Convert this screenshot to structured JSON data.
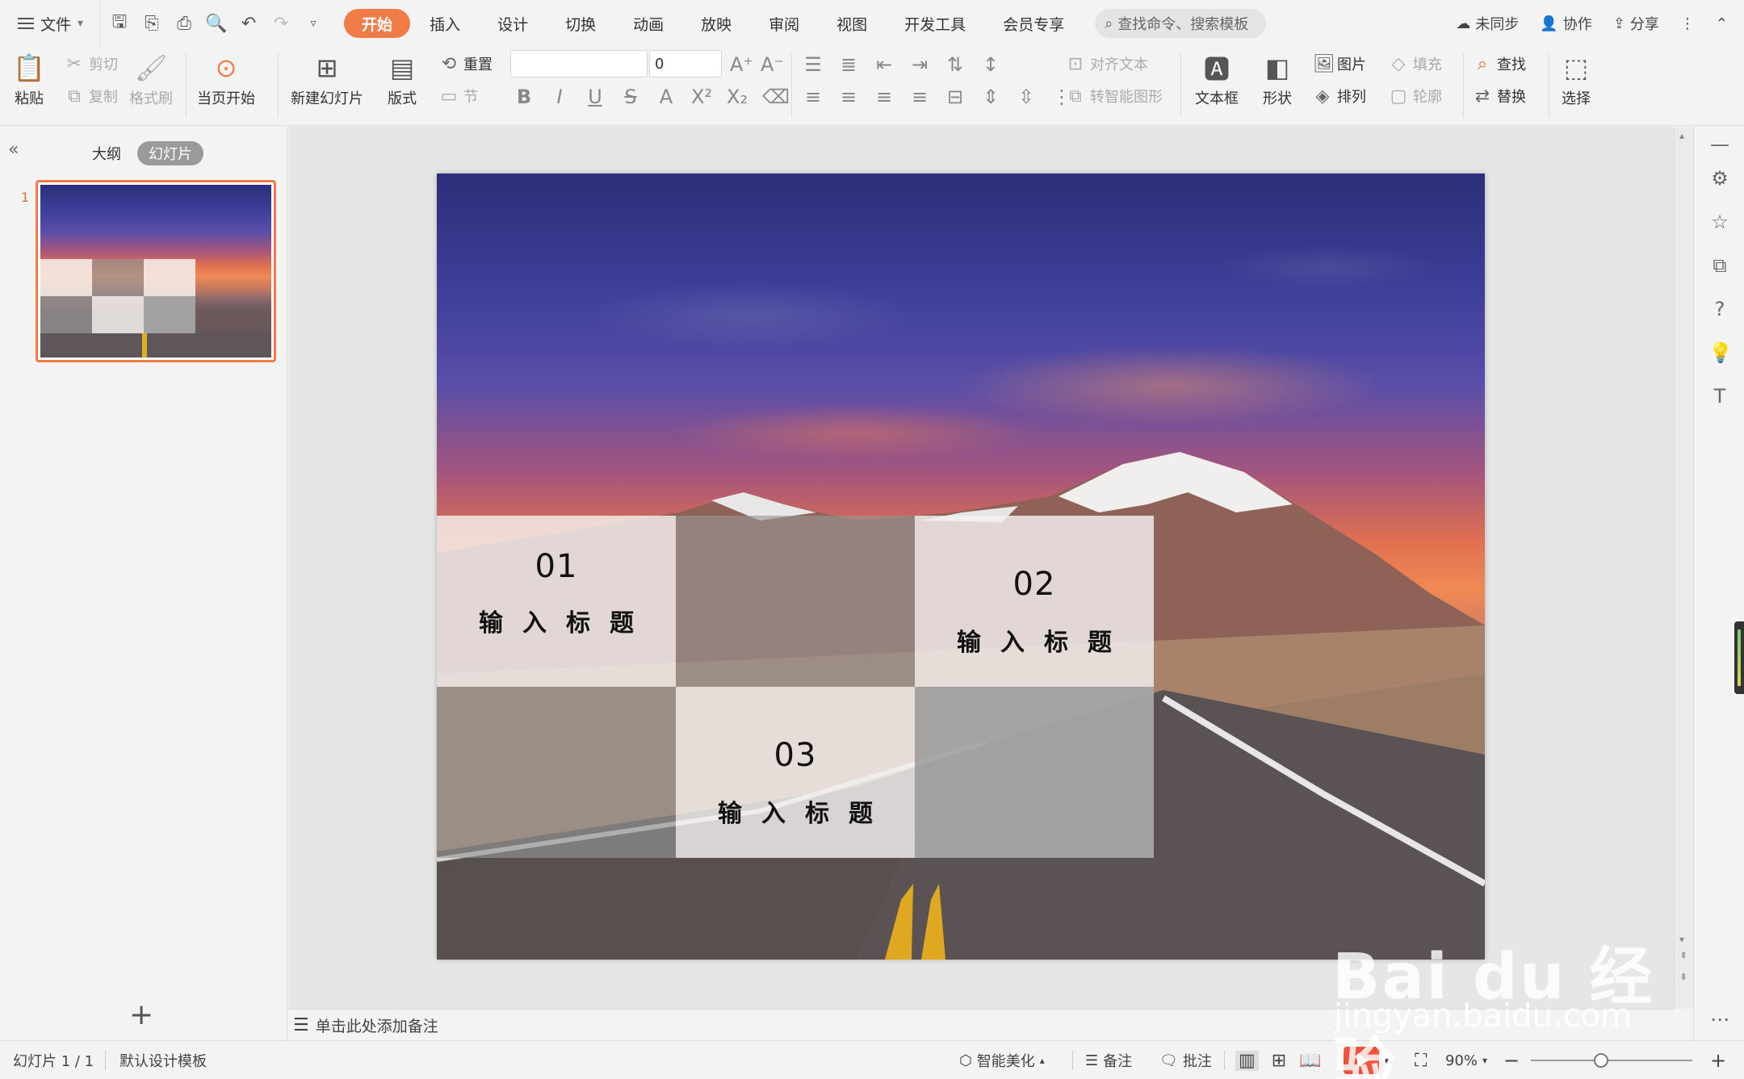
{
  "menubar": {
    "file_label": "文件",
    "tabs": [
      {
        "label": "开始",
        "active": true
      },
      {
        "label": "插入"
      },
      {
        "label": "设计"
      },
      {
        "label": "切换"
      },
      {
        "label": "动画"
      },
      {
        "label": "放映"
      },
      {
        "label": "审阅"
      },
      {
        "label": "视图"
      },
      {
        "label": "开发工具"
      },
      {
        "label": "会员专享"
      }
    ],
    "search_placeholder": "查找命令、搜索模板",
    "right": {
      "sync": "未同步",
      "collab": "协作",
      "share": "分享"
    }
  },
  "ribbon": {
    "paste": "粘贴",
    "cut": "剪切",
    "copy": "复制",
    "format_painter": "格式刷",
    "from_current": "当页开始",
    "new_slide": "新建幻灯片",
    "layout": "版式",
    "reset": "重置",
    "section": "节",
    "font_size": "0",
    "align_text": "对齐文本",
    "smart_art": "转智能图形",
    "textbox": "文本框",
    "shape": "形状",
    "picture": "图片",
    "fill": "填充",
    "arrange": "排列",
    "outline": "轮廓",
    "find": "查找",
    "replace": "替换",
    "select": "选择"
  },
  "leftpanel": {
    "tab_outline": "大纲",
    "tab_slides": "幻灯片",
    "slide_number": "1"
  },
  "slide": {
    "tiles": [
      {
        "num": "01",
        "title": "输入标题"
      },
      {
        "num": "02",
        "title": "输入标题"
      },
      {
        "num": "03",
        "title": "输入标题"
      }
    ]
  },
  "notes_placeholder": "单击此处添加备注",
  "statusbar": {
    "slide_counter": "幻灯片 1 / 1",
    "template": "默认设计模板",
    "beautify": "智能美化",
    "notes": "备注",
    "comments": "批注",
    "zoom": "90%"
  },
  "watermark": {
    "text": "Bai du 经验",
    "url": "jingyan.baidu.com"
  },
  "colors": {
    "accent": "#f17c48",
    "play": "#f0533a"
  }
}
